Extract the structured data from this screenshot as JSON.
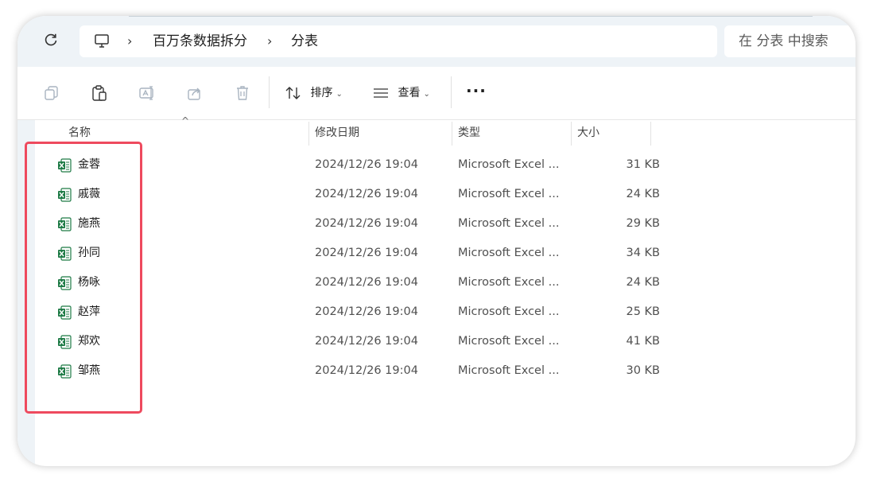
{
  "address": {
    "crumbs": [
      "百万条数据拆分",
      "分表"
    ],
    "search_placeholder": "在 分表 中搜索"
  },
  "toolbar": {
    "sort_label": "排序",
    "view_label": "查看",
    "more_label": "···"
  },
  "columns": {
    "name": "名称",
    "modified": "修改日期",
    "type": "类型",
    "size": "大小"
  },
  "files": [
    {
      "name": "金蓉",
      "modified": "2024/12/26 19:04",
      "type": "Microsoft Excel ...",
      "size": "31 KB"
    },
    {
      "name": "戚薇",
      "modified": "2024/12/26 19:04",
      "type": "Microsoft Excel ...",
      "size": "24 KB"
    },
    {
      "name": "施燕",
      "modified": "2024/12/26 19:04",
      "type": "Microsoft Excel ...",
      "size": "29 KB"
    },
    {
      "name": "孙同",
      "modified": "2024/12/26 19:04",
      "type": "Microsoft Excel ...",
      "size": "34 KB"
    },
    {
      "name": "杨咏",
      "modified": "2024/12/26 19:04",
      "type": "Microsoft Excel ...",
      "size": "24 KB"
    },
    {
      "name": "赵萍",
      "modified": "2024/12/26 19:04",
      "type": "Microsoft Excel ...",
      "size": "25 KB"
    },
    {
      "name": "郑欢",
      "modified": "2024/12/26 19:04",
      "type": "Microsoft Excel ...",
      "size": "41 KB"
    },
    {
      "name": "邹燕",
      "modified": "2024/12/26 19:04",
      "type": "Microsoft Excel ...",
      "size": "30 KB"
    }
  ],
  "colors": {
    "highlight": "#ee4a5e",
    "excel_green": "#1d7a45",
    "address_bg": "#eef3f7"
  },
  "icons": [
    "refresh-icon",
    "this-pc-icon",
    "copy-icon",
    "paste-icon",
    "rename-icon",
    "share-icon",
    "delete-icon",
    "sort-icon",
    "view-icon",
    "more-icon",
    "excel-file-icon"
  ]
}
